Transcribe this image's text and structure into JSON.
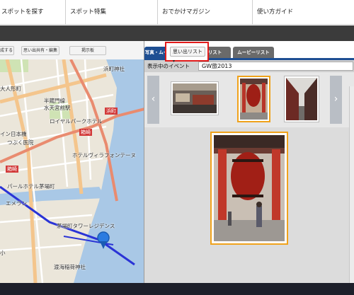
{
  "nav": {
    "items": [
      "スポットを探す",
      "スポット特集",
      "おでかけマガジン",
      "使い方ガイド"
    ]
  },
  "map": {
    "buttons": [
      "成する",
      "思い出共有・編集",
      "掲示板"
    ],
    "labels": [
      "浜町神社",
      "半蔵門線",
      "水天宮前駅",
      "ロイヤルパークホテル",
      "浜町",
      "イン日本橋",
      "箱崎",
      "つぶく医院",
      "ホテルヴィラフォンテーヌ",
      "箱崎",
      "パールホテル茅場町",
      "エメラン",
      "茅場町タワーレジデンス",
      "渡海稲荷神社",
      "小",
      "大人形町"
    ],
    "colors": {
      "water": "#a9c8e6",
      "land": "#ebe6da",
      "road": "#f4c58c",
      "route": "#2a33d6"
    }
  },
  "panel": {
    "tabs": [
      "写真・ムービービュー",
      "写真リスト",
      "ムービーリスト"
    ],
    "memory_button": "思い出リスト",
    "event_label": "表示中のイベント",
    "event_value": "GW旅2013",
    "prev_icon": "chevron-left-icon",
    "next_icon": "chevron-right-icon",
    "accent_color": "#1e4f93",
    "highlight_color": "#e21b1b",
    "selected_border": "#f0a21b"
  }
}
